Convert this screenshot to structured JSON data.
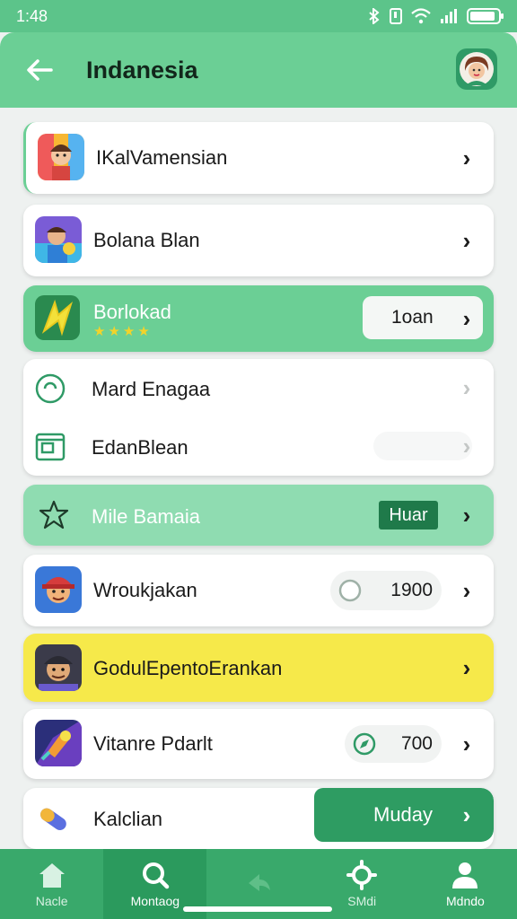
{
  "status_bar": {
    "time": "1:48",
    "icons": [
      "bluetooth-icon",
      "nfc-icon",
      "wifi-icon",
      "signal-icon",
      "battery-icon"
    ]
  },
  "header": {
    "back_icon": "arrow-left-icon",
    "title": "Indanesia",
    "avatar_icon": "profile-avatar-icon"
  },
  "items": [
    {
      "label": "IKalVamensian"
    },
    {
      "label": "Bolana Blan"
    },
    {
      "label": "Borlokad",
      "button_label": "1oan"
    },
    {
      "label": "Mard Enagaa"
    },
    {
      "label": "EdanBlean"
    },
    {
      "label": "Mile Bamaia",
      "badge": "Huar"
    },
    {
      "label": "Wroukjakan",
      "value": "1900"
    },
    {
      "label": "GodulEpentoErankan"
    },
    {
      "label": "Vitanre Pdarlt",
      "value": "700"
    },
    {
      "label": "Kalclian",
      "button_label": "Muday"
    }
  ],
  "bottom_nav": [
    {
      "label": "Nacle",
      "icon": "home-icon"
    },
    {
      "label": "Montaog",
      "icon": "search-icon"
    },
    {
      "label": "",
      "icon": "share-icon"
    },
    {
      "label": "SMdi",
      "icon": "settings-gear-icon"
    },
    {
      "label": "Mdndo",
      "icon": "person-icon"
    }
  ],
  "colors": {
    "header": "#6bcf95",
    "accent_green": "#2b9a5d",
    "highlight_green": "#8fdcb1",
    "highlight_yellow": "#f6e94a"
  }
}
